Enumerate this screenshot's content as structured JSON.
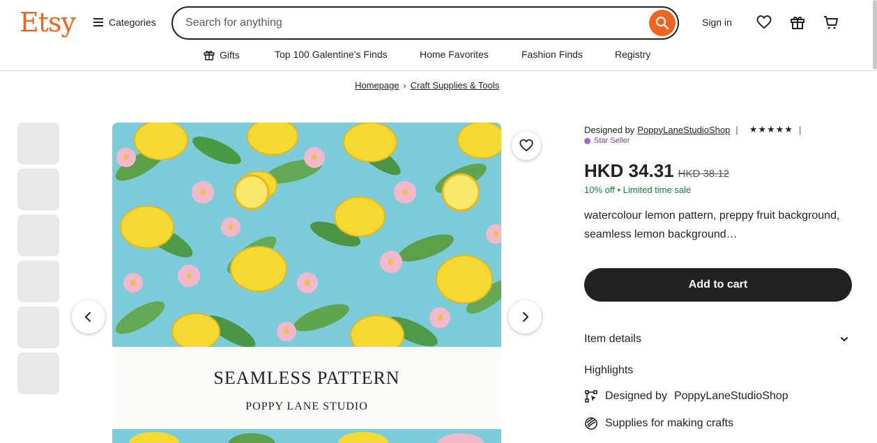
{
  "header": {
    "logo": "Etsy",
    "categories_label": "Categories",
    "search_placeholder": "Search for anything",
    "signin_label": "Sign in",
    "icons": [
      "search-icon",
      "heart-icon",
      "gift-icon",
      "cart-icon"
    ]
  },
  "nav": {
    "items": [
      {
        "label": "Gifts",
        "icon": "gift-icon"
      },
      {
        "label": "Top 100 Galentine’s Finds"
      },
      {
        "label": "Home Favorites"
      },
      {
        "label": "Fashion Finds"
      },
      {
        "label": "Registry"
      }
    ]
  },
  "breadcrumb": [
    "Homepage",
    "Craft Supplies & Tools"
  ],
  "product": {
    "image_title": "SEAMLESS PATTERN",
    "image_subtitle": "POPPY LANE STUDIO",
    "thumbnail_count": 6,
    "designed_by_prefix": "Designed by",
    "shop_name": "PoppyLaneStudioShop",
    "stars": "★★★★★",
    "rating": 5,
    "star_seller": "Star Seller",
    "price": "HKD 34.31",
    "original_price": "HKD 38.12",
    "discount": "10% off",
    "sale_note": "Limited time sale",
    "description": "watercolour lemon pattern, preppy fruit background, seamless lemon background…",
    "add_to_cart": "Add to cart",
    "item_details": "Item details",
    "highlights_title": "Highlights",
    "highlights": [
      {
        "prefix": "Designed by",
        "value": "PoppyLaneStudioShop",
        "icon": "designed-icon"
      },
      {
        "prefix": "Supplies for making crafts",
        "value": "",
        "icon": "supplies-icon"
      }
    ]
  },
  "colors": {
    "brand": "#f1641e",
    "text": "#222222",
    "sale_green": "#1a7b3a",
    "star_seller_purple": "#7a3e9d",
    "cart_button": "#222222"
  }
}
